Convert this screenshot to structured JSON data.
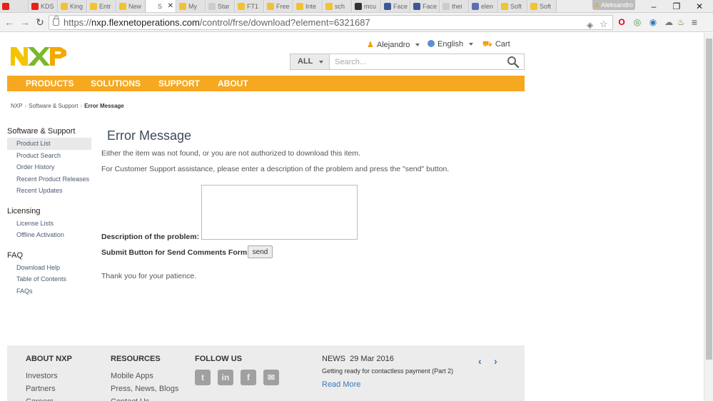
{
  "browser": {
    "tabs": [
      {
        "label": "",
        "favicon_color": "#e62117"
      },
      {
        "label": "KDS",
        "favicon_color": "#e62117"
      },
      {
        "label": "King",
        "favicon_color": "#f1c232"
      },
      {
        "label": "Entr",
        "favicon_color": "#f1c232"
      },
      {
        "label": "New",
        "favicon_color": "#f1c232"
      },
      {
        "label": "S",
        "favicon_color": "#ffffff"
      },
      {
        "label": "My",
        "favicon_color": "#f1c232"
      },
      {
        "label": "Star",
        "favicon_color": "#cccccc"
      },
      {
        "label": "FT1",
        "favicon_color": "#f1c232"
      },
      {
        "label": "Free",
        "favicon_color": "#f1c232"
      },
      {
        "label": "Inte",
        "favicon_color": "#f1c232"
      },
      {
        "label": "sch",
        "favicon_color": "#f1c232"
      },
      {
        "label": "mcu",
        "favicon_color": "#333333"
      },
      {
        "label": "Face",
        "favicon_color": "#3b5998"
      },
      {
        "label": "Face",
        "favicon_color": "#3b5998"
      },
      {
        "label": "thei",
        "favicon_color": "#cccccc"
      },
      {
        "label": "elen",
        "favicon_color": "#5b6fb5"
      },
      {
        "label": "Soft",
        "favicon_color": "#f1c232"
      },
      {
        "label": "Soft",
        "favicon_color": "#f1c232"
      }
    ],
    "active_tab_index": 5,
    "profile_name": "Aleksandro",
    "url_scheme": "https://",
    "url_host": "nxp.flexnetoperations.com",
    "url_path": "/control/frse/download?element=6321687"
  },
  "header": {
    "user": "Alejandro",
    "language": "English",
    "cart": "Cart",
    "search_scope": "ALL",
    "search_placeholder": "Search..."
  },
  "nav": [
    "PRODUCTS",
    "SOLUTIONS",
    "SUPPORT",
    "ABOUT"
  ],
  "breadcrumb": [
    "NXP",
    "Software & Support",
    "Error Message"
  ],
  "sidebar": {
    "sections": [
      {
        "title": "Software & Support",
        "items": [
          "Product List",
          "Product Search",
          "Order History",
          "Recent Product Releases",
          "Recent Updates"
        ]
      },
      {
        "title": "Licensing",
        "items": [
          "License Lists",
          "Offline Activation"
        ]
      },
      {
        "title": "FAQ",
        "items": [
          "Download Help",
          "Table of Contents",
          "FAQs"
        ]
      }
    ],
    "selected": "Product List"
  },
  "content": {
    "title": "Error Message",
    "message": "Either the item was not found, or you are not authorized to download this item.",
    "support_text": "For Customer Support assistance, please enter a description of the problem and press the \"send\" button.",
    "description_label": "Description of the problem:",
    "submit_label": "Submit Button for Send Comments Form",
    "send_button": "send",
    "thanks": "Thank you for your patience."
  },
  "footer": {
    "about": {
      "title": "ABOUT NXP",
      "links": [
        "Investors",
        "Partners",
        "Careers"
      ]
    },
    "resources": {
      "title": "RESOURCES",
      "links": [
        "Mobile Apps",
        "Press, News, Blogs",
        "Contact Us"
      ]
    },
    "follow": {
      "title": "FOLLOW US",
      "icons": [
        "twitter-icon",
        "linkedin-icon",
        "facebook-icon",
        "email-icon"
      ]
    },
    "news": {
      "label": "NEWS",
      "date": "29 Mar 2016",
      "headline": "Getting ready for contactless payment (Part 2)",
      "read_more": "Read More"
    }
  },
  "colors": {
    "accent": "#f6a820",
    "link": "#3a78b6",
    "footer_bg": "#ececec"
  }
}
